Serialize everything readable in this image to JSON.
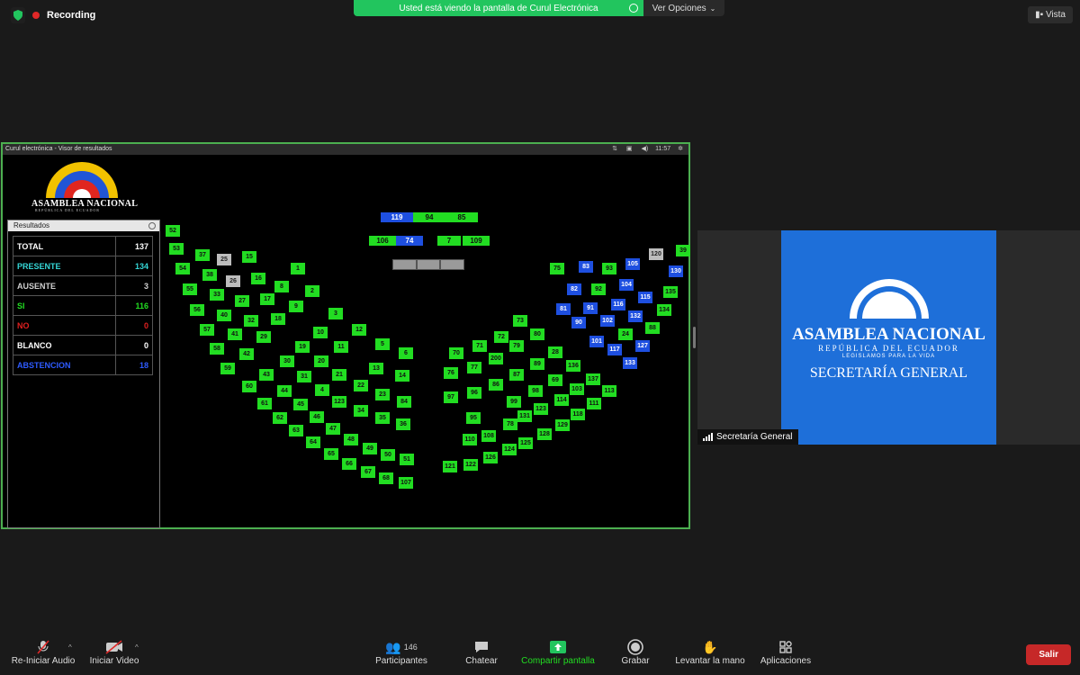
{
  "top": {
    "recording": "Recording",
    "share_message": "Usted está viendo la pantalla de Curul Electrónica",
    "view_options": "Ver Opciones",
    "view": "Vista"
  },
  "screen": {
    "title": "Curul electrónica - Visor de resultados",
    "clock": "11:57",
    "logo_name": "ASAMBLEA NACIONAL",
    "logo_sub": "REPÚBLICA DEL ECUADOR",
    "results_title": "Resultados",
    "results": [
      {
        "label": "TOTAL",
        "value": "137",
        "color": "#ffffff"
      },
      {
        "label": "PRESENTE",
        "value": "134",
        "color": "#35d7d7"
      },
      {
        "label": "AUSENTE",
        "value": "3",
        "color": "#cfcfcf"
      },
      {
        "label": "SI",
        "value": "116",
        "color": "#22dd22"
      },
      {
        "label": "NO",
        "value": "0",
        "color": "#e02020"
      },
      {
        "label": "BLANCO",
        "value": "0",
        "color": "#ffffff"
      },
      {
        "label": "ABSTENCION",
        "value": "18",
        "color": "#2e5bff"
      }
    ],
    "top_seats": [
      {
        "n": "119",
        "s": "blue"
      },
      {
        "n": "94",
        "s": "green"
      },
      {
        "n": "85",
        "s": "green"
      },
      {
        "n": "106",
        "s": "green"
      },
      {
        "n": "74",
        "s": "blue"
      },
      {
        "n": "7",
        "s": "green"
      },
      {
        "n": "109",
        "s": "green"
      }
    ],
    "seats": [
      {
        "n": "52",
        "s": "green"
      },
      {
        "n": "53",
        "s": "green"
      },
      {
        "n": "54",
        "s": "green"
      },
      {
        "n": "55",
        "s": "green"
      },
      {
        "n": "56",
        "s": "green"
      },
      {
        "n": "57",
        "s": "green"
      },
      {
        "n": "58",
        "s": "green"
      },
      {
        "n": "59",
        "s": "green"
      },
      {
        "n": "37",
        "s": "green"
      },
      {
        "n": "38",
        "s": "green"
      },
      {
        "n": "33",
        "s": "green"
      },
      {
        "n": "40",
        "s": "green"
      },
      {
        "n": "41",
        "s": "green"
      },
      {
        "n": "42",
        "s": "green"
      },
      {
        "n": "25",
        "s": "gray"
      },
      {
        "n": "26",
        "s": "gray"
      },
      {
        "n": "27",
        "s": "green"
      },
      {
        "n": "32",
        "s": "green"
      },
      {
        "n": "29",
        "s": "green"
      },
      {
        "n": "15",
        "s": "green"
      },
      {
        "n": "16",
        "s": "green"
      },
      {
        "n": "17",
        "s": "green"
      },
      {
        "n": "18",
        "s": "green"
      },
      {
        "n": "8",
        "s": "green"
      },
      {
        "n": "9",
        "s": "green"
      },
      {
        "n": "1",
        "s": "green"
      },
      {
        "n": "2",
        "s": "green"
      },
      {
        "n": "3",
        "s": "green"
      },
      {
        "n": "12",
        "s": "green"
      },
      {
        "n": "5",
        "s": "green"
      },
      {
        "n": "6",
        "s": "green"
      },
      {
        "n": "10",
        "s": "green"
      },
      {
        "n": "11",
        "s": "green"
      },
      {
        "n": "13",
        "s": "green"
      },
      {
        "n": "14",
        "s": "green"
      },
      {
        "n": "19",
        "s": "green"
      },
      {
        "n": "20",
        "s": "green"
      },
      {
        "n": "21",
        "s": "green"
      },
      {
        "n": "22",
        "s": "green"
      },
      {
        "n": "23",
        "s": "green"
      },
      {
        "n": "84",
        "s": "green"
      },
      {
        "n": "30",
        "s": "green"
      },
      {
        "n": "31",
        "s": "green"
      },
      {
        "n": "4",
        "s": "green"
      },
      {
        "n": "123",
        "s": "green"
      },
      {
        "n": "34",
        "s": "green"
      },
      {
        "n": "35",
        "s": "green"
      },
      {
        "n": "36",
        "s": "green"
      },
      {
        "n": "43",
        "s": "green"
      },
      {
        "n": "44",
        "s": "green"
      },
      {
        "n": "45",
        "s": "green"
      },
      {
        "n": "46",
        "s": "green"
      },
      {
        "n": "47",
        "s": "green"
      },
      {
        "n": "48",
        "s": "green"
      },
      {
        "n": "49",
        "s": "green"
      },
      {
        "n": "50",
        "s": "green"
      },
      {
        "n": "51",
        "s": "green"
      },
      {
        "n": "60",
        "s": "green"
      },
      {
        "n": "61",
        "s": "green"
      },
      {
        "n": "62",
        "s": "green"
      },
      {
        "n": "63",
        "s": "green"
      },
      {
        "n": "64",
        "s": "green"
      },
      {
        "n": "65",
        "s": "green"
      },
      {
        "n": "66",
        "s": "green"
      },
      {
        "n": "67",
        "s": "green"
      },
      {
        "n": "68",
        "s": "green"
      },
      {
        "n": "107",
        "s": "green"
      },
      {
        "n": "70",
        "s": "green"
      },
      {
        "n": "71",
        "s": "green"
      },
      {
        "n": "72",
        "s": "green"
      },
      {
        "n": "73",
        "s": "green"
      },
      {
        "n": "76",
        "s": "green"
      },
      {
        "n": "77",
        "s": "green"
      },
      {
        "n": "200",
        "s": "green"
      },
      {
        "n": "79",
        "s": "green"
      },
      {
        "n": "80",
        "s": "green"
      },
      {
        "n": "97",
        "s": "green"
      },
      {
        "n": "96",
        "s": "green"
      },
      {
        "n": "86",
        "s": "green"
      },
      {
        "n": "87",
        "s": "green"
      },
      {
        "n": "89",
        "s": "green"
      },
      {
        "n": "28",
        "s": "green"
      },
      {
        "n": "99",
        "s": "green"
      },
      {
        "n": "98",
        "s": "green"
      },
      {
        "n": "69",
        "s": "green"
      },
      {
        "n": "136",
        "s": "green"
      },
      {
        "n": "95",
        "s": "green"
      },
      {
        "n": "78",
        "s": "green"
      },
      {
        "n": "131",
        "s": "green"
      },
      {
        "n": "123",
        "s": "green"
      },
      {
        "n": "114",
        "s": "green"
      },
      {
        "n": "103",
        "s": "green"
      },
      {
        "n": "137",
        "s": "green"
      },
      {
        "n": "110",
        "s": "green"
      },
      {
        "n": "108",
        "s": "green"
      },
      {
        "n": "125",
        "s": "green"
      },
      {
        "n": "128",
        "s": "green"
      },
      {
        "n": "129",
        "s": "green"
      },
      {
        "n": "118",
        "s": "green"
      },
      {
        "n": "111",
        "s": "green"
      },
      {
        "n": "113",
        "s": "green"
      },
      {
        "n": "121",
        "s": "green"
      },
      {
        "n": "122",
        "s": "green"
      },
      {
        "n": "126",
        "s": "green"
      },
      {
        "n": "124",
        "s": "green"
      },
      {
        "n": "75",
        "s": "green"
      },
      {
        "n": "83",
        "s": "blue"
      },
      {
        "n": "82",
        "s": "blue"
      },
      {
        "n": "81",
        "s": "blue"
      },
      {
        "n": "90",
        "s": "blue"
      },
      {
        "n": "93",
        "s": "green"
      },
      {
        "n": "92",
        "s": "green"
      },
      {
        "n": "91",
        "s": "blue"
      },
      {
        "n": "102",
        "s": "blue"
      },
      {
        "n": "101",
        "s": "blue"
      },
      {
        "n": "105",
        "s": "blue"
      },
      {
        "n": "104",
        "s": "blue"
      },
      {
        "n": "116",
        "s": "blue"
      },
      {
        "n": "24",
        "s": "green"
      },
      {
        "n": "117",
        "s": "blue"
      },
      {
        "n": "120",
        "s": "gray"
      },
      {
        "n": "115",
        "s": "blue"
      },
      {
        "n": "132",
        "s": "blue"
      },
      {
        "n": "127",
        "s": "blue"
      },
      {
        "n": "133",
        "s": "blue"
      },
      {
        "n": "39",
        "s": "green"
      },
      {
        "n": "130",
        "s": "blue"
      },
      {
        "n": "135",
        "s": "green"
      },
      {
        "n": "134",
        "s": "green"
      },
      {
        "n": "88",
        "s": "green"
      }
    ]
  },
  "participant": {
    "tile_name": "ASAMBLEA NACIONAL",
    "tile_rep": "REPÚBLICA DEL ECUADOR",
    "tile_motto": "LEGISLAMOS PARA LA VIDA",
    "tile_secretaria": "SECRETARÍA GENERAL",
    "name": "Secretaría General"
  },
  "toolbar": {
    "audio": "Re-Iniciar Audio",
    "video": "Iniciar Video",
    "participants": "Participantes",
    "participants_count": "146",
    "chat": "Chatear",
    "share": "Compartir pantalla",
    "record": "Grabar",
    "raise_hand": "Levantar la mano",
    "apps": "Aplicaciones",
    "leave": "Salir"
  }
}
